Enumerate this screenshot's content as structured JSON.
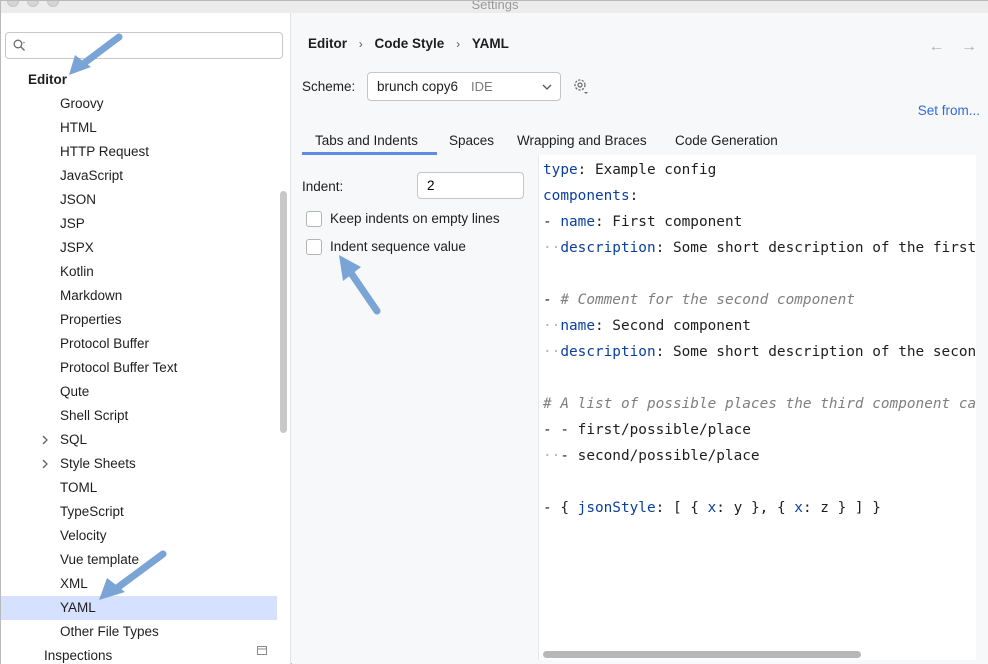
{
  "window": {
    "title": "Settings"
  },
  "sidebar": {
    "search_placeholder": "",
    "items": [
      {
        "label": "Editor",
        "level": 0,
        "bold": true,
        "selected": false,
        "expandable": false
      },
      {
        "label": "Groovy",
        "level": 1,
        "selected": false,
        "expandable": false
      },
      {
        "label": "HTML",
        "level": 1,
        "selected": false,
        "expandable": false
      },
      {
        "label": "HTTP Request",
        "level": 1,
        "selected": false,
        "expandable": false
      },
      {
        "label": "JavaScript",
        "level": 1,
        "selected": false,
        "expandable": false
      },
      {
        "label": "JSON",
        "level": 1,
        "selected": false,
        "expandable": false
      },
      {
        "label": "JSP",
        "level": 1,
        "selected": false,
        "expandable": false
      },
      {
        "label": "JSPX",
        "level": 1,
        "selected": false,
        "expandable": false
      },
      {
        "label": "Kotlin",
        "level": 1,
        "selected": false,
        "expandable": false
      },
      {
        "label": "Markdown",
        "level": 1,
        "selected": false,
        "expandable": false
      },
      {
        "label": "Properties",
        "level": 1,
        "selected": false,
        "expandable": false
      },
      {
        "label": "Protocol Buffer",
        "level": 1,
        "selected": false,
        "expandable": false
      },
      {
        "label": "Protocol Buffer Text",
        "level": 1,
        "selected": false,
        "expandable": false
      },
      {
        "label": "Qute",
        "level": 1,
        "selected": false,
        "expandable": false
      },
      {
        "label": "Shell Script",
        "level": 1,
        "selected": false,
        "expandable": false
      },
      {
        "label": "SQL",
        "level": 1,
        "selected": false,
        "expandable": true
      },
      {
        "label": "Style Sheets",
        "level": 1,
        "selected": false,
        "expandable": true
      },
      {
        "label": "TOML",
        "level": 1,
        "selected": false,
        "expandable": false
      },
      {
        "label": "TypeScript",
        "level": 1,
        "selected": false,
        "expandable": false
      },
      {
        "label": "Velocity",
        "level": 1,
        "selected": false,
        "expandable": false
      },
      {
        "label": "Vue template",
        "level": 1,
        "selected": false,
        "expandable": false
      },
      {
        "label": "XML",
        "level": 1,
        "selected": false,
        "expandable": false
      },
      {
        "label": "YAML",
        "level": 1,
        "selected": true,
        "expandable": false
      },
      {
        "label": "Other File Types",
        "level": 1,
        "selected": false,
        "expandable": false
      },
      {
        "label": "Inspections",
        "level": 0.5,
        "selected": false,
        "expandable": false
      }
    ]
  },
  "breadcrumb": [
    "Editor",
    "Code Style",
    "YAML"
  ],
  "nav": {
    "back": "←",
    "forward": "→"
  },
  "scheme": {
    "label": "Scheme:",
    "value": "brunch copy6",
    "tag": "IDE"
  },
  "set_from": "Set from...",
  "tabs": [
    "Tabs and Indents",
    "Spaces",
    "Wrapping and Braces",
    "Code Generation"
  ],
  "active_tab": 0,
  "indent": {
    "label": "Indent:",
    "value": "2"
  },
  "checkboxes": [
    {
      "label": "Keep indents on empty lines",
      "checked": false
    },
    {
      "label": "Indent sequence value",
      "checked": false
    }
  ],
  "preview_lines": [
    [
      [
        "k",
        "type"
      ],
      [
        "t",
        ": Example config"
      ]
    ],
    [
      [
        "k",
        "components"
      ],
      [
        "t",
        ":"
      ]
    ],
    [
      [
        "t",
        "- "
      ],
      [
        "k",
        "name"
      ],
      [
        "t",
        ": First component"
      ]
    ],
    [
      [
        "d",
        "··"
      ],
      [
        "k",
        "description"
      ],
      [
        "t",
        ": Some short description of the first"
      ]
    ],
    [],
    [
      [
        "t",
        "- "
      ],
      [
        "c",
        "# Comment for the second component"
      ]
    ],
    [
      [
        "d",
        "··"
      ],
      [
        "k",
        "name"
      ],
      [
        "t",
        ": Second component"
      ]
    ],
    [
      [
        "d",
        "··"
      ],
      [
        "k",
        "description"
      ],
      [
        "t",
        ": Some short description of the second"
      ]
    ],
    [],
    [
      [
        "c",
        "# A list of possible places the third component can"
      ]
    ],
    [
      [
        "t",
        "- - first/possible/place"
      ]
    ],
    [
      [
        "d",
        "··"
      ],
      [
        "t",
        "- second/possible/place"
      ]
    ],
    [],
    [
      [
        "t",
        "- { "
      ],
      [
        "k",
        "jsonStyle"
      ],
      [
        "t",
        ": [ { "
      ],
      [
        "k",
        "x"
      ],
      [
        "t",
        ": y }, { "
      ],
      [
        "k",
        "x"
      ],
      [
        "t",
        ": z } ] }"
      ]
    ]
  ],
  "colors": {
    "accent": "#5f8be0",
    "selection": "#d5e1ff",
    "key": "#0b3f9e",
    "link": "#2f6bdb",
    "annotation_arrow": "#7aa3d6"
  }
}
